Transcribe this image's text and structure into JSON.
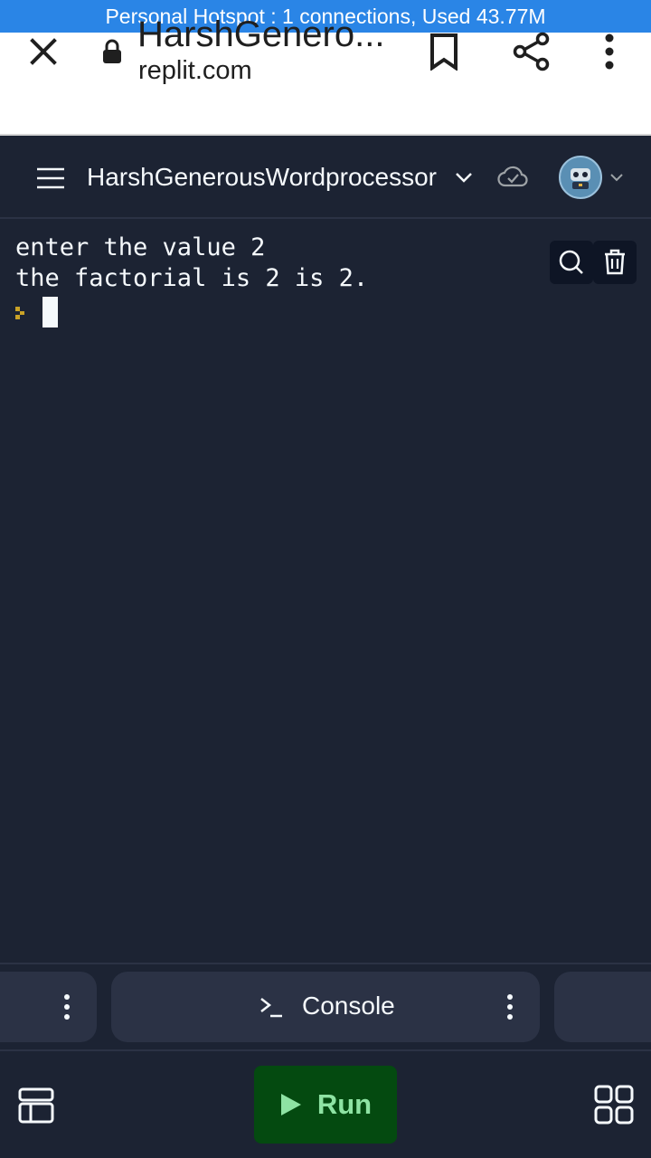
{
  "status_bar": {
    "text": "Personal Hotspot : 1 connections, Used 43.77M"
  },
  "browser": {
    "page_title": "HarshGenero...",
    "host": "replit.com",
    "icons": [
      "close-icon",
      "lock-icon",
      "bookmark-icon",
      "share-icon",
      "more-vertical-icon"
    ]
  },
  "header": {
    "repl_name": "HarshGenerousWordprocessor",
    "icons": [
      "hamburger-menu-icon",
      "chevron-down-icon",
      "cloud-check-icon",
      "avatar",
      "chevron-down-icon"
    ]
  },
  "console": {
    "lines": [
      "enter the value 2",
      "the factorial is 2 is 2."
    ],
    "icons": [
      "search-icon",
      "trash-icon",
      "prompt-icon"
    ]
  },
  "tabs": {
    "console_label": "Console"
  },
  "bottom": {
    "run_label": "Run"
  },
  "colors": {
    "status_bar": "#2a85e6",
    "background": "#1c2333",
    "tab": "#2b3245",
    "run_button": "#044a10",
    "run_text": "#8ee3a3",
    "prompt": "#c9a227"
  }
}
